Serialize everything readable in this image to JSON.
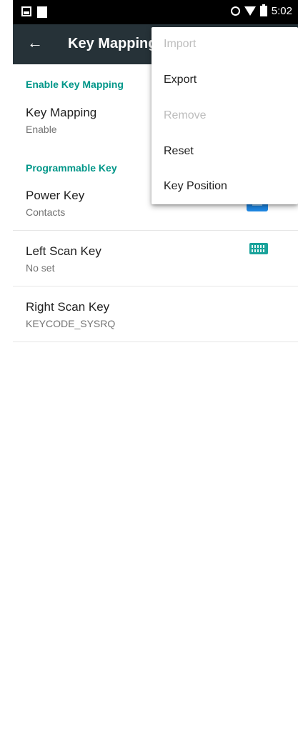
{
  "status_bar": {
    "time": "5:02",
    "left_icons": [
      "image-notification-icon",
      "blank-notification-icon"
    ],
    "right_icons": [
      "alarm-icon",
      "wifi-icon",
      "battery-icon"
    ]
  },
  "toolbar": {
    "back_icon": "arrow-left-icon",
    "title": "Key Mapping",
    "background": "#263238"
  },
  "sections": [
    {
      "header": "Enable Key Mapping",
      "items": [
        {
          "title": "Key Mapping",
          "summary": "Enable"
        }
      ]
    },
    {
      "header": "Programmable Key",
      "items": [
        {
          "title": "Power Key",
          "summary": "Contacts",
          "icon": "contacts-icon"
        },
        {
          "title": "Left Scan Key",
          "summary": "No set"
        },
        {
          "title": "Right Scan Key",
          "summary": "KEYCODE_SYSRQ",
          "icon": "keyboard-icon"
        }
      ]
    }
  ],
  "overflow_menu": {
    "items": [
      {
        "label": "Import",
        "enabled": false
      },
      {
        "label": "Export",
        "enabled": true
      },
      {
        "label": "Remove",
        "enabled": false
      },
      {
        "label": "Reset",
        "enabled": true
      },
      {
        "label": "Key Position",
        "enabled": true
      }
    ]
  },
  "colors": {
    "accent": "#009688",
    "toolbar": "#263238",
    "status_bar": "#000000"
  }
}
